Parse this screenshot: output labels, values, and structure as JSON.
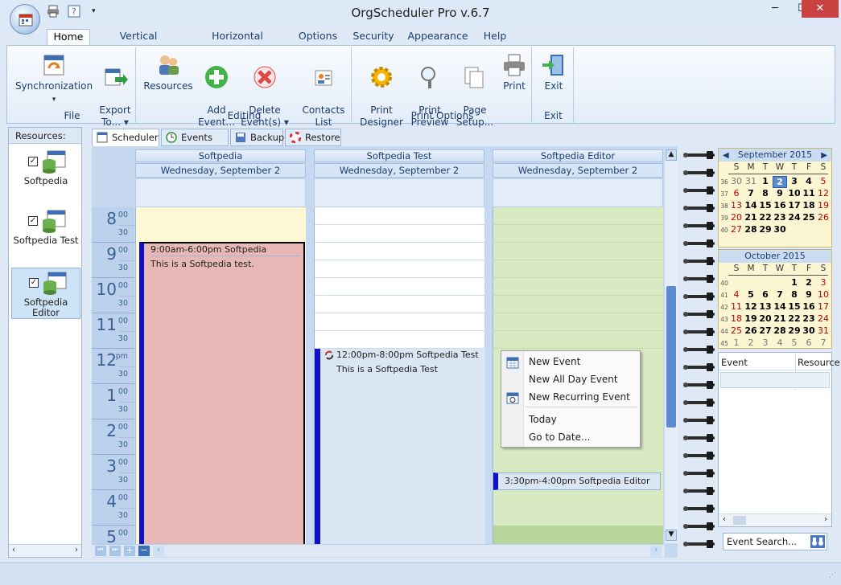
{
  "window": {
    "title": "OrgScheduler Pro v.6.7",
    "controls": {
      "minimize": "─",
      "maximize": "☐",
      "close": "✕"
    }
  },
  "menu_tabs": [
    "Home",
    "Vertical Timeline",
    "Horizontal Timeline",
    "Options",
    "Security",
    "Appearance",
    "Help"
  ],
  "ribbon": {
    "groups": {
      "file": "File",
      "editing": "Editing",
      "print_options": "Print Options",
      "exit": "Exit"
    },
    "buttons": {
      "synchronization": "Synchronization",
      "export_to": "Export\nTo... ▾",
      "resources": "Resources",
      "add_event": "Add\nEvent...",
      "delete_events": "Delete\nEvent(s) ▾",
      "contacts_list": "Contacts\nList",
      "print_designer": "Print\nDesigner",
      "print_preview": "Print\nPreview",
      "page_setup": "Page\nSetup...",
      "print": "Print",
      "exit": "Exit"
    }
  },
  "resources_panel": {
    "header": "Resources:",
    "items": [
      {
        "label": "Softpedia",
        "checked": true
      },
      {
        "label": "Softpedia Test",
        "checked": true
      },
      {
        "label": "Softpedia Editor",
        "checked": true
      }
    ]
  },
  "view_tabs": [
    "Scheduler",
    "Events List",
    "Backup",
    "Restore"
  ],
  "scheduler": {
    "date": "Wednesday, September 2",
    "columns": [
      "Softpedia",
      "Softpedia Test",
      "Softpedia Editor"
    ],
    "hours": [
      {
        "h": "8",
        "suffix": "00"
      },
      {
        "h": "9",
        "suffix": "00"
      },
      {
        "h": "10",
        "suffix": "00"
      },
      {
        "h": "11",
        "suffix": "00"
      },
      {
        "h": "12",
        "suffix": "pm"
      },
      {
        "h": "1",
        "suffix": "00"
      },
      {
        "h": "2",
        "suffix": "00"
      },
      {
        "h": "3",
        "suffix": "00"
      },
      {
        "h": "4",
        "suffix": "00"
      },
      {
        "h": "5",
        "suffix": "00"
      }
    ],
    "half_label": "30",
    "events": [
      {
        "title": "9:00am-6:00pm Softpedia",
        "body": "This is a Softpedia test."
      },
      {
        "title": "12:00pm-8:00pm Softpedia Test",
        "body": "This is a Softpedia Test"
      },
      {
        "title": "3:30pm-4:00pm Softpedia Editor",
        "body": ""
      }
    ]
  },
  "context_menu": [
    "New Event",
    "New All Day Event",
    "New Recurring Event",
    "Today",
    "Go to Date..."
  ],
  "calendars": {
    "dow": [
      "S",
      "M",
      "T",
      "W",
      "T",
      "F",
      "S"
    ],
    "months": [
      {
        "title": "September 2015",
        "weeks": [
          "36",
          "37",
          "38",
          "39",
          "40"
        ],
        "rows": [
          [
            "30",
            "31",
            "1",
            "2",
            "3",
            "4",
            "5"
          ],
          [
            "6",
            "7",
            "8",
            "9",
            "10",
            "11",
            "12"
          ],
          [
            "13",
            "14",
            "15",
            "16",
            "17",
            "18",
            "19"
          ],
          [
            "20",
            "21",
            "22",
            "23",
            "24",
            "25",
            "26"
          ],
          [
            "27",
            "28",
            "29",
            "30",
            "",
            "",
            ""
          ]
        ]
      },
      {
        "title": "October 2015",
        "weeks": [
          "40",
          "41",
          "42",
          "43",
          "44",
          "45"
        ],
        "rows": [
          [
            "",
            "",
            "",
            "",
            "1",
            "2",
            "3"
          ],
          [
            "4",
            "5",
            "6",
            "7",
            "8",
            "9",
            "10"
          ],
          [
            "11",
            "12",
            "13",
            "14",
            "15",
            "16",
            "17"
          ],
          [
            "18",
            "19",
            "20",
            "21",
            "22",
            "23",
            "24"
          ],
          [
            "25",
            "26",
            "27",
            "28",
            "29",
            "30",
            "31"
          ],
          [
            "1",
            "2",
            "3",
            "4",
            "5",
            "6",
            "7"
          ]
        ]
      }
    ]
  },
  "event_list": {
    "col_event": "Event",
    "col_resource": "Resource",
    "search_placeholder": "Event Search..."
  },
  "colors": {
    "accent": "#3c6fb4",
    "event_softpedia": "#e7b8b6",
    "event_test": "#dbe6f5",
    "editor_col": "#d8eac2",
    "today": "#5b8bd1"
  }
}
